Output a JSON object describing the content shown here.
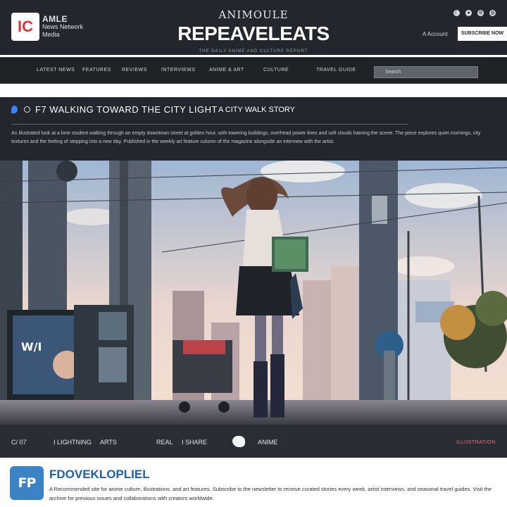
{
  "header": {
    "logo": "IC",
    "brand_line1": "AMLE",
    "brand_line2": "News Network",
    "brand_line3": "Media",
    "kicker": "ANIMOULE",
    "title": "REPEAVELEATS",
    "tagline": "THE DAILY ANIME AND CULTURE REPORT",
    "account_label": "A Account",
    "subscribe_label": "SUBSCRIBE NOW",
    "top_icons": [
      "theme-icon",
      "user-icon",
      "settings-icon",
      "globe-icon"
    ]
  },
  "nav": {
    "items": [
      "LATEST NEWS",
      "FEATURES",
      "REVIEWS",
      "INTERVIEWS",
      "ANIME & ART",
      "CULTURE",
      "TRAVEL GUIDE"
    ],
    "search_placeholder": "Search"
  },
  "article": {
    "headline": "F7 WALKING TOWARD THE CITY LIGHT",
    "subhead": "A CITY WALK STORY",
    "lede": "An illustrated look at a lone student walking through an empty downtown street at golden hour, with towering buildings, overhead power lines and soft clouds framing the scene. The piece explores quiet mornings, city textures and the feeling of stepping into a new day. Published in the weekly art feature column of the magazine alongside an interview with the artist."
  },
  "caption": {
    "left": "C/ 07",
    "items": [
      "I LIGHTNING",
      "ARTS",
      "REAL",
      "I SHARE",
      "ANIME"
    ],
    "credit": "ILLUSTRATION"
  },
  "footer": {
    "logo": "FP",
    "name": "FDOVEKLOPLIEL",
    "text": "A Recommended site for anime culture, illustrations, and art features. Subscribe to the newsletter to receive curated stories every week, artist interviews, and seasonal travel guides. Visit the archive for previous issues and collaborations with creators worldwide."
  },
  "colors": {
    "header_bg": "#23272d",
    "accent_red": "#d9363e",
    "brand_blue": "#1d5fae",
    "sky_top": "#b9cbe0",
    "sky_glow": "#f6e2d2"
  }
}
